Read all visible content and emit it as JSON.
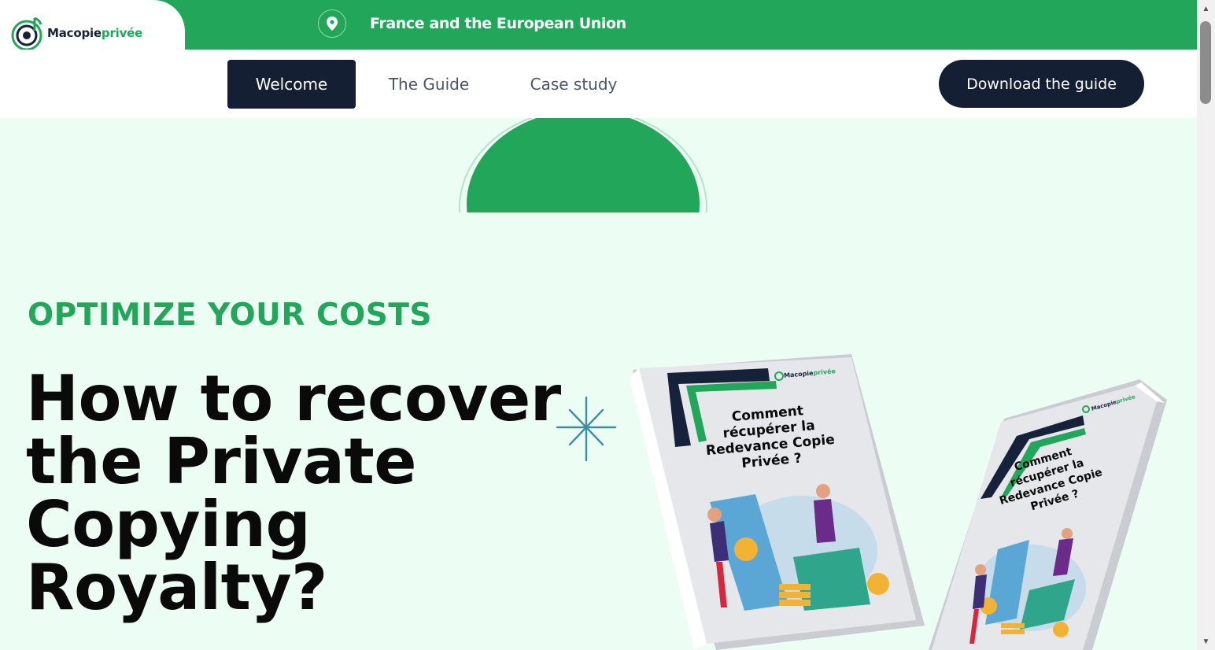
{
  "brand": {
    "name_part1": "Macopie",
    "name_part2": "privée"
  },
  "topbar": {
    "location_icon": "map-pin-icon",
    "location_text": "France and the European Union"
  },
  "nav": {
    "items": [
      {
        "label": "Welcome",
        "active": true
      },
      {
        "label": "The Guide",
        "active": false
      },
      {
        "label": "Case study",
        "active": false
      }
    ],
    "cta_label": "Download the guide"
  },
  "hero": {
    "eyebrow": "OPTIMIZE YOUR COSTS",
    "headline_lines": [
      "How to recover",
      "the Private",
      "Copying",
      "Royalty?"
    ]
  },
  "books": [
    {
      "brand_part1": "Macopie",
      "brand_part2": "privée",
      "title_lines": [
        "Comment",
        "récupérer la",
        "Redevance Copie",
        "Privée ?"
      ]
    },
    {
      "brand_part1": "Macopie",
      "brand_part2": "privée",
      "title_lines": [
        "Comment",
        "récupérer la",
        "Redevance Copie",
        "Privée ?"
      ]
    }
  ],
  "colors": {
    "brand_green": "#22a659",
    "navy": "#151f33",
    "hero_background": "#ecfdf4"
  }
}
